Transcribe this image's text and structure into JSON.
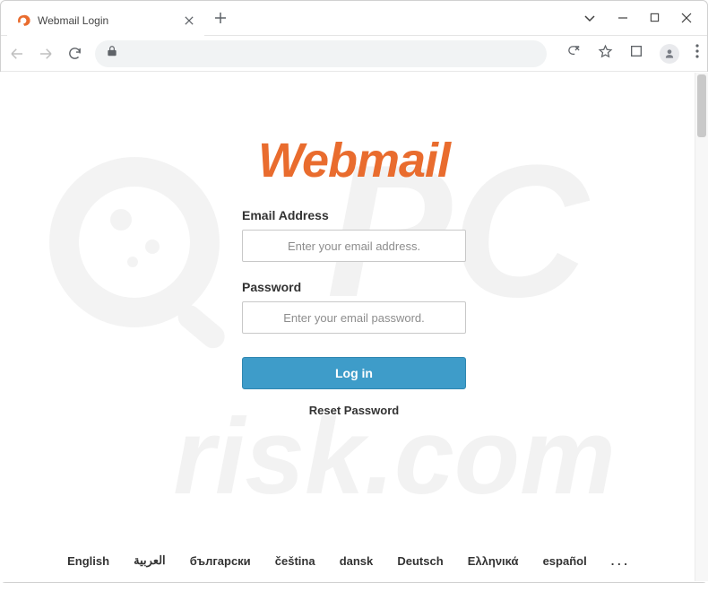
{
  "browser": {
    "tab_title": "Webmail Login",
    "window_controls": {
      "dropdown": "⌄",
      "minimize": "—",
      "maximize": "□",
      "close": "✕"
    }
  },
  "page": {
    "logo": "Webmail",
    "form": {
      "email_label": "Email Address",
      "email_placeholder": "Enter your email address.",
      "password_label": "Password",
      "password_placeholder": "Enter your email password.",
      "login_button": "Log in",
      "reset_link": "Reset Password"
    },
    "languages": [
      "English",
      "العربية",
      "български",
      "čeština",
      "dansk",
      "Deutsch",
      "Ελληνικά",
      "español",
      ". . ."
    ]
  },
  "watermark": {
    "text_main": "PC",
    "text_sub": "risk.com"
  }
}
